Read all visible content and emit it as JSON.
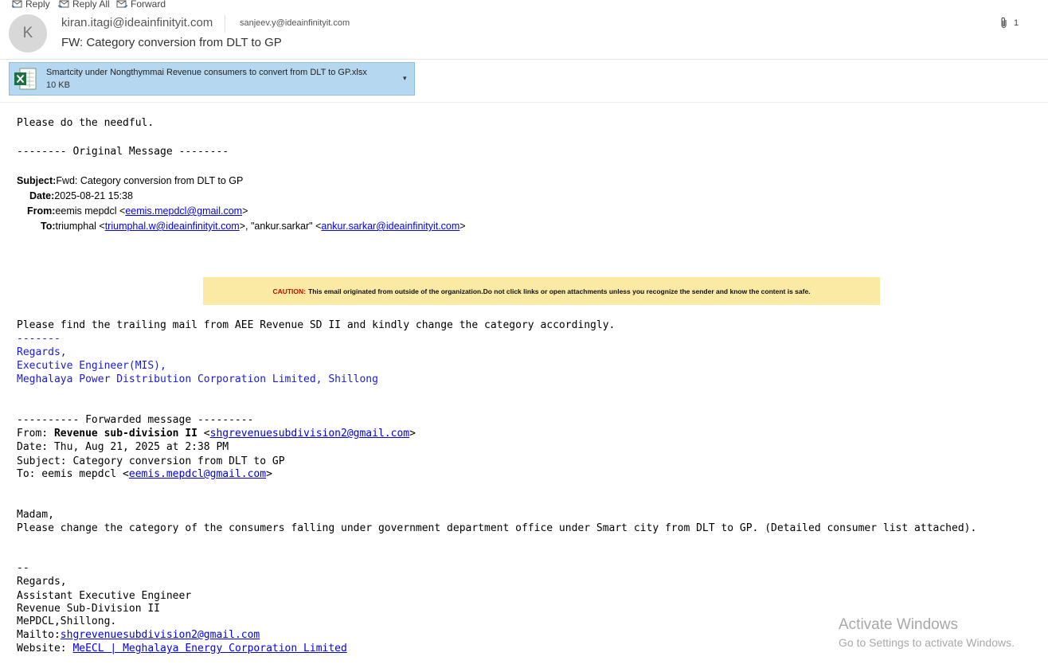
{
  "toolbar": {
    "reply": "Reply",
    "reply_all": "Reply All",
    "forward": "Forward"
  },
  "header": {
    "avatar_initial": "K",
    "sender": "kiran.itagi@ideainfinityit.com",
    "recipient": "sanjeev.y@ideainfinityit.com",
    "subject": "FW: Category conversion from DLT to GP",
    "attachment_count": "1"
  },
  "attachment": {
    "icon": "excel-file-icon",
    "name": "Smartcity under Nongthymmai Revenue consumers to convert from DLT to GP.xlsx",
    "size": "10 KB"
  },
  "body": {
    "opening": "Please do the needful.",
    "original_marker": "-------- Original Message --------",
    "orig": {
      "subject_label": "Subject:",
      "subject": "Fwd: Category conversion from DLT to GP",
      "date_label": "Date:",
      "date": "2025-08-21 15:38",
      "from_label": "From:",
      "from_name": "eemis mepdcl <",
      "from_email": "eemis.mepdcl@gmail.com",
      "from_close": ">",
      "to_label": "To:",
      "to_name1": "triumphal <",
      "to_email1": "triumphal.w@ideainfinityit.com",
      "to_mid": ">, \"ankur.sarkar\" <",
      "to_email2": "ankur.sarkar@ideainfinityit.com",
      "to_close": ">"
    },
    "caution": {
      "label": "CAUTION:",
      "text": "This email originated from outside of the organization.Do not click links or open attachments unless you recognize the sender and know the content is safe."
    },
    "trailing": "Please find the trailing mail from AEE Revenue SD II and kindly change the category accordingly.",
    "sig1": {
      "dashes": "-------",
      "regards": "Regards,",
      "title": "Executive Engineer(MIS),",
      "org": "Meghalaya Power Distribution Corporation Limited, Shillong"
    },
    "fwd": {
      "marker": "---------- Forwarded message ---------",
      "from_prefix": "From: ",
      "from_name": "Revenue sub-division II",
      "from_open": " <",
      "from_email": "shgrevenuesubdivision2@gmail.com",
      "from_close": ">",
      "date": "Date: Thu, Aug 21, 2025 at 2:38 PM",
      "subject": "Subject: Category conversion from DLT to GP",
      "to_prefix": "To: eemis mepdcl <",
      "to_email": "eemis.mepdcl@gmail.com",
      "to_close": ">"
    },
    "greeting": "Madam,",
    "request": "Please change the category of the consumers falling under government department office under Smart city from DLT to GP. (Detailed consumer list attached).",
    "sig2": {
      "dashes": "--",
      "regards": "Regards,",
      "title": "Assistant Executive Engineer",
      "division": "Revenue Sub-Division II",
      "org": "MePDCL,Shillong.",
      "mailto_label": "Mailto:",
      "mailto_email": "shgrevenuesubdivision2@gmail.com",
      "website_label": "Website: ",
      "website_link": "MeECL | Meghalaya Energy Corporation Limited"
    }
  },
  "watermark": {
    "title": "Activate Windows",
    "subtitle": "Go to Settings to activate Windows."
  }
}
